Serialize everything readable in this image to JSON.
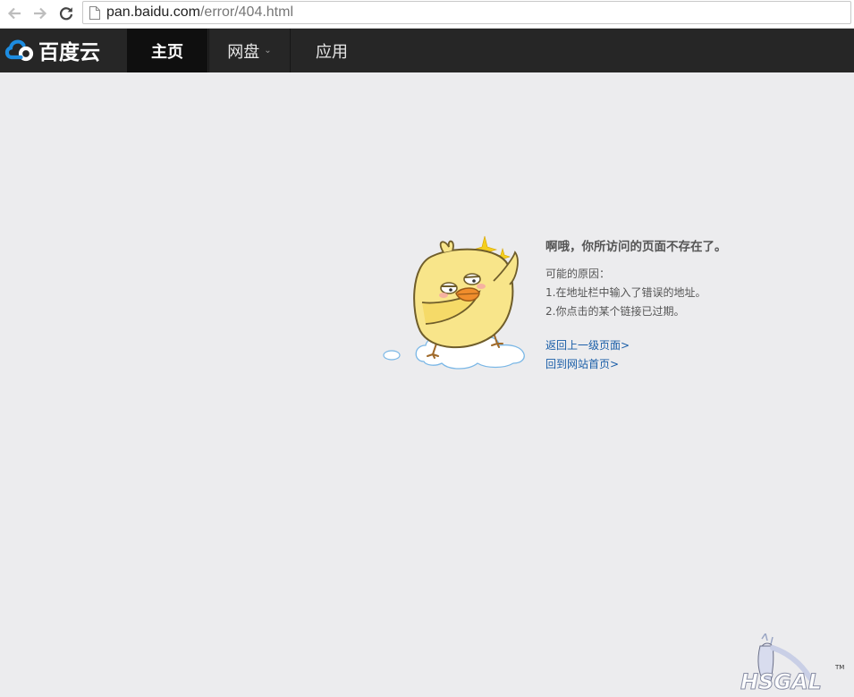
{
  "browser": {
    "url_host": "pan.baidu.com",
    "url_path": "/error/404.html"
  },
  "nav": {
    "brand": "百度云",
    "tabs": [
      {
        "label": "主页",
        "active": true
      },
      {
        "label": "网盘",
        "has_dropdown": true
      },
      {
        "label": "应用"
      }
    ],
    "dropdown_caret": "⌄"
  },
  "error": {
    "title": "啊哦，你所访问的页面不存在了。",
    "reasons_heading": "可能的原因：",
    "reasons": [
      "1.在地址栏中输入了错误的地址。",
      "2.你点击的某个链接已过期。"
    ],
    "links": [
      {
        "label": "返回上一级页面>"
      },
      {
        "label": "回到网站首页>"
      }
    ]
  },
  "watermark": {
    "text": "HSGAL",
    "tm": "TM"
  },
  "colors": {
    "page_bg": "#ececee",
    "nav_bg": "#262626",
    "nav_active_bg": "#0f0f0f",
    "link": "#1a5ea8",
    "brand_blue": "#1d8ce0"
  }
}
